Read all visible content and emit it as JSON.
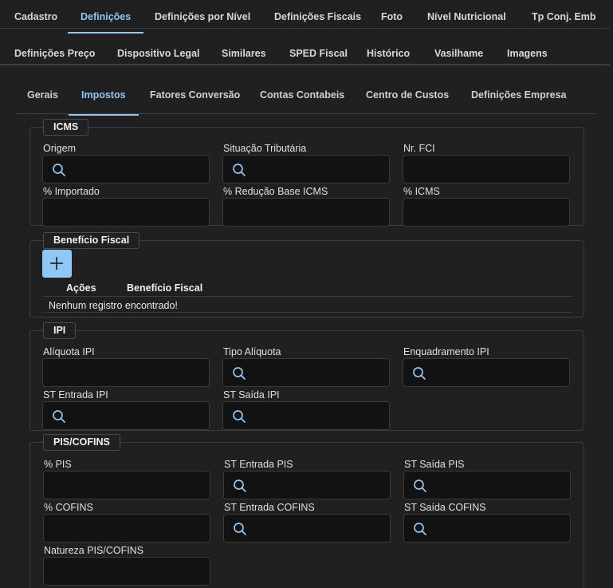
{
  "top_tabs_row1": [
    "Cadastro",
    "Definições",
    "Definições por Nível",
    "Definições Fiscais",
    "Foto",
    "Nível Nutricional",
    "Tp Conj. Emb"
  ],
  "top_tabs_row2": [
    "Definições Preço",
    "Dispositivo Legal",
    "Similares",
    "SPED Fiscal",
    "Histórico",
    "Vasilhame",
    "Imagens"
  ],
  "sub_tabs": [
    "Gerais",
    "Impostos",
    "Fatores Conversão",
    "Contas Contabeis",
    "Centro de Custos",
    "Definições Empresa"
  ],
  "icms": {
    "legend": "ICMS",
    "origem": "Origem",
    "situacao": "Situação Tributária",
    "nr_fci": "Nr. FCI",
    "importado": "% Importado",
    "reducao": "% Redução Base ICMS",
    "icms_pct": "% ICMS"
  },
  "beneficio": {
    "legend": "Benefício Fiscal",
    "col_acoes": "Ações",
    "col_beneficio": "Benefício Fiscal",
    "empty": "Nenhum registro encontrado!"
  },
  "ipi": {
    "legend": "IPI",
    "aliquota": "Alíquota IPI",
    "tipo": "Tipo Alíquota",
    "enquadramento": "Enquadramento IPI",
    "st_entrada": "ST Entrada IPI",
    "st_saida": "ST Saída IPI"
  },
  "pis": {
    "legend": "PIS/COFINS",
    "pis_pct": "% PIS",
    "st_entrada_pis": "ST Entrada PIS",
    "st_saida_pis": "ST Saída PIS",
    "cofins_pct": "% COFINS",
    "st_entrada_cofins": "ST Entrada COFINS",
    "st_saida_cofins": "ST Saída COFINS",
    "natureza": "Natureza PIS/COFINS"
  },
  "colors": {
    "accent": "#8fc7f5",
    "background": "#202020",
    "input_bg": "#121212"
  }
}
